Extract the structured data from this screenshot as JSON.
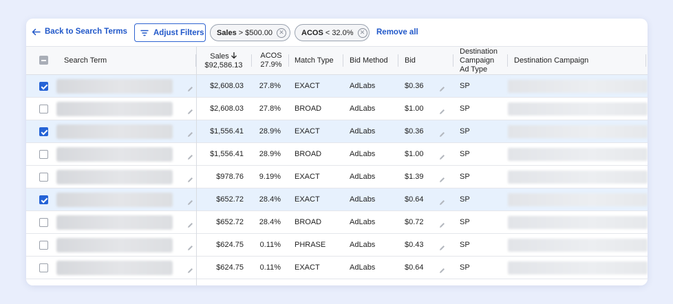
{
  "toolbar": {
    "back_label": "Back to Search Terms",
    "adjust_filters_label": "Adjust Filters",
    "filters": [
      {
        "field": "Sales",
        "op": " > $500.00"
      },
      {
        "field": "ACOS",
        "op": " < 32.0%"
      }
    ],
    "remove_all_label": "Remove all"
  },
  "colors": {
    "accent": "#2563d6",
    "selected_row": "#e7f1fd",
    "page_bg": "#e9eefc"
  },
  "table": {
    "headers": {
      "search_term": "Search Term",
      "sales": "Sales",
      "sales_total": "$92,586.13",
      "acos": "ACOS",
      "acos_total": "27.9%",
      "match_type": "Match Type",
      "bid_method": "Bid Method",
      "bid": "Bid",
      "dest_ad_type_1": "Destination",
      "dest_ad_type_2": "Campaign",
      "dest_ad_type_3": "Ad Type",
      "dest_campaign": "Destination Campaign"
    },
    "sort_icon": "arrow-down-icon",
    "rows": [
      {
        "selected": true,
        "sales": "$2,608.03",
        "acos": "27.8%",
        "match": "EXACT",
        "method": "AdLabs",
        "bid": "$0.36",
        "ad_type": "SP"
      },
      {
        "selected": false,
        "sales": "$2,608.03",
        "acos": "27.8%",
        "match": "BROAD",
        "method": "AdLabs",
        "bid": "$1.00",
        "ad_type": "SP"
      },
      {
        "selected": true,
        "sales": "$1,556.41",
        "acos": "28.9%",
        "match": "EXACT",
        "method": "AdLabs",
        "bid": "$0.36",
        "ad_type": "SP"
      },
      {
        "selected": false,
        "sales": "$1,556.41",
        "acos": "28.9%",
        "match": "BROAD",
        "method": "AdLabs",
        "bid": "$1.00",
        "ad_type": "SP"
      },
      {
        "selected": false,
        "sales": "$978.76",
        "acos": "9.19%",
        "match": "EXACT",
        "method": "AdLabs",
        "bid": "$1.39",
        "ad_type": "SP"
      },
      {
        "selected": true,
        "sales": "$652.72",
        "acos": "28.4%",
        "match": "EXACT",
        "method": "AdLabs",
        "bid": "$0.64",
        "ad_type": "SP"
      },
      {
        "selected": false,
        "sales": "$652.72",
        "acos": "28.4%",
        "match": "BROAD",
        "method": "AdLabs",
        "bid": "$0.72",
        "ad_type": "SP"
      },
      {
        "selected": false,
        "sales": "$624.75",
        "acos": "0.11%",
        "match": "PHRASE",
        "method": "AdLabs",
        "bid": "$0.43",
        "ad_type": "SP"
      },
      {
        "selected": false,
        "sales": "$624.75",
        "acos": "0.11%",
        "match": "EXACT",
        "method": "AdLabs",
        "bid": "$0.64",
        "ad_type": "SP"
      }
    ]
  }
}
